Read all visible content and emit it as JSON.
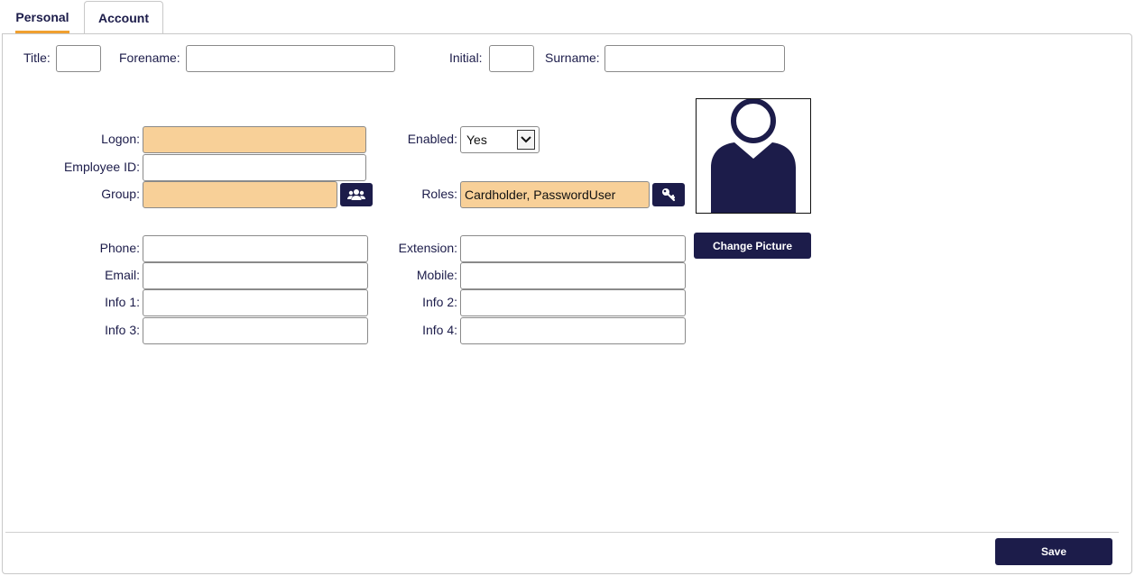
{
  "tabs": {
    "personal": "Personal",
    "account": "Account"
  },
  "name_row": {
    "title_label": "Title:",
    "forename_label": "Forename:",
    "initial_label": "Initial:",
    "surname_label": "Surname:",
    "title_value": "",
    "forename_value": "",
    "initial_value": "",
    "surname_value": ""
  },
  "account": {
    "logon_label": "Logon:",
    "logon_value": "",
    "employee_id_label": "Employee ID:",
    "employee_id_value": "",
    "group_label": "Group:",
    "group_value": "",
    "enabled_label": "Enabled:",
    "enabled_value": "Yes",
    "roles_label": "Roles:",
    "roles_value": "Cardholder, PasswordUser"
  },
  "contact": {
    "phone_label": "Phone:",
    "email_label": "Email:",
    "info1_label": "Info 1:",
    "info3_label": "Info 3:",
    "extension_label": "Extension:",
    "mobile_label": "Mobile:",
    "info2_label": "Info 2:",
    "info4_label": "Info 4:"
  },
  "picture": {
    "change_label": "Change Picture"
  },
  "footer": {
    "save_label": "Save"
  },
  "colors": {
    "accent": "#1c1c4a",
    "required": "#f8d098",
    "tab_underline": "#f0a030"
  },
  "icons": {
    "group_button": "users-icon",
    "roles_button": "key-icon",
    "avatar": "person-silhouette-icon",
    "select_arrow": "chevron-down-icon"
  }
}
